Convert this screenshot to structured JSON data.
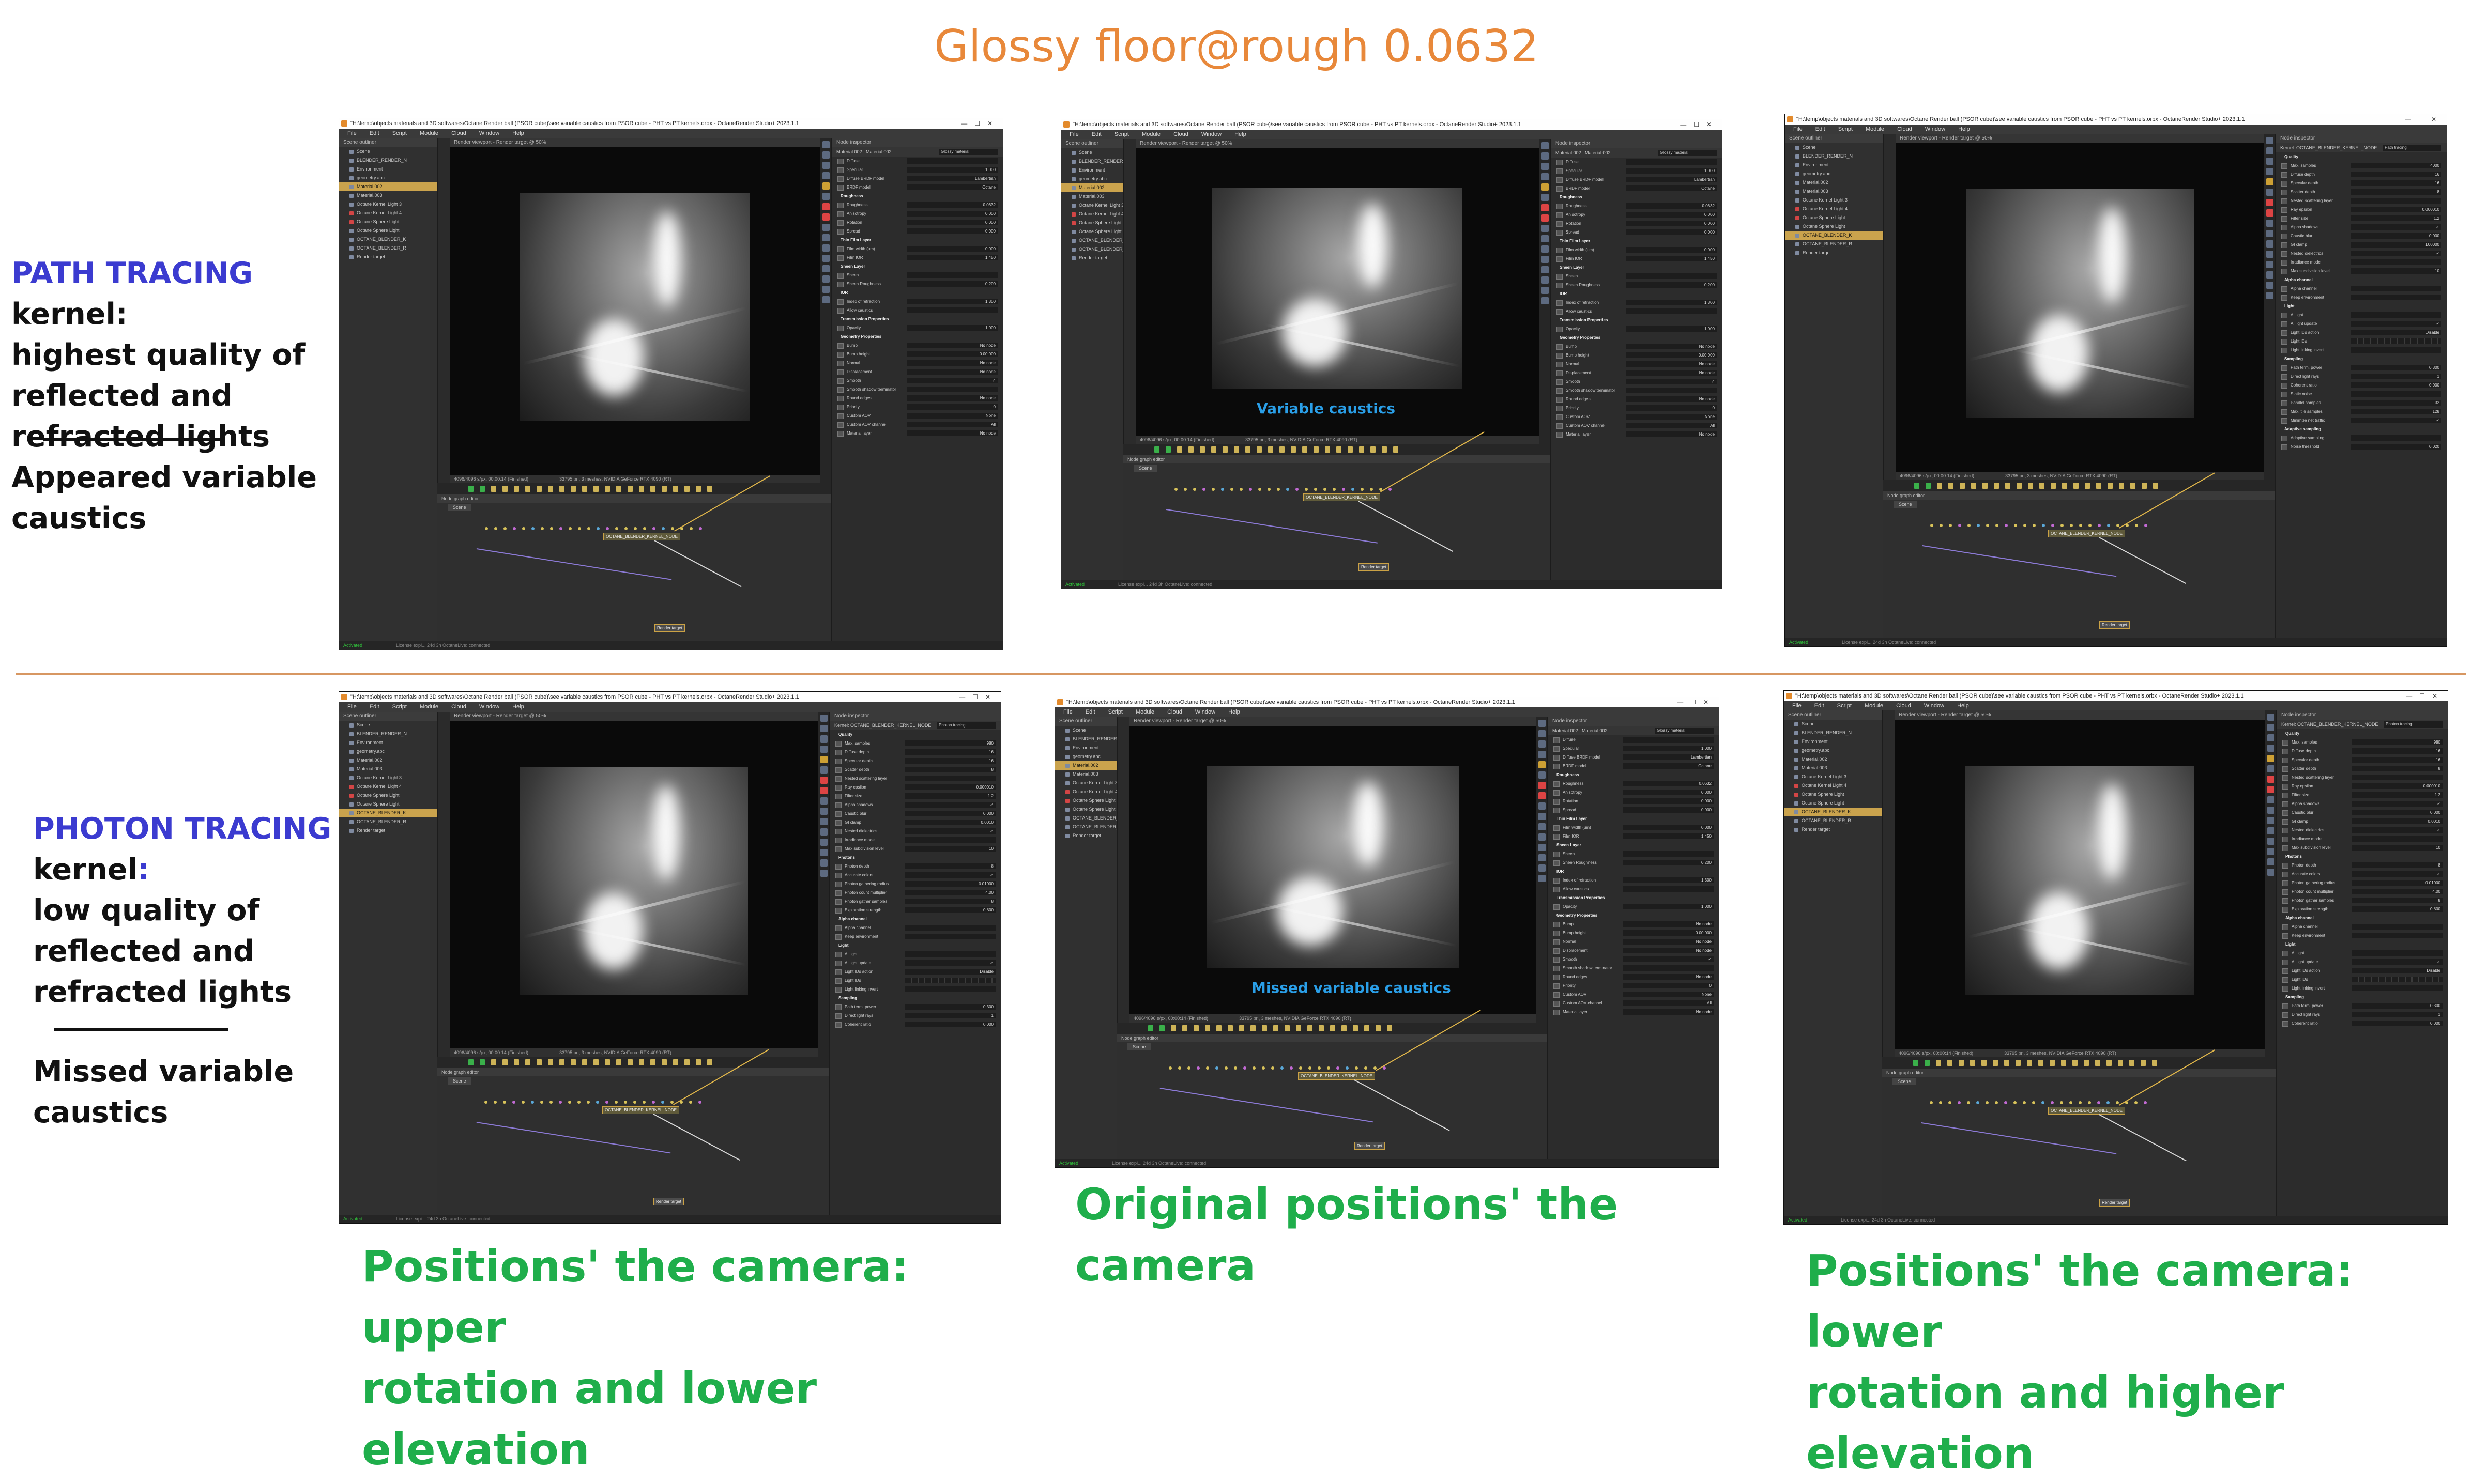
{
  "title": "Glossy floor@rough 0.0632",
  "path_tracing": {
    "kernel_name": "PATH TRACING",
    "kernel_word": " kernel:",
    "line1": "highest quality of",
    "line2": "reflected and",
    "line3": "refracted lights",
    "note1": "Appeared variable",
    "note2": "caustics"
  },
  "photon_tracing": {
    "kernel_name": "PHOTON TRACING",
    "kernel_word": "kernel",
    "colon": ":",
    "line1": "low quality of",
    "line2": "reflected and",
    "line3": "refracted lights",
    "note1": "Missed variable",
    "note2": "caustics"
  },
  "captions": {
    "top_center_viewport": "Variable caustics",
    "bottom_center_viewport": "Missed variable caustics",
    "center": "Original positions' the camera",
    "left_line1": "Positions' the camera: upper",
    "left_line2": "rotation and lower elevation",
    "right_line1": "Positions' the camera: lower",
    "right_line2": "rotation and higher elevation"
  },
  "octane": {
    "window_title": "\"H:\\temp\\objects materials and 3D softwares\\Octane Render ball (PSOR cube)\\see variable caustics from PSOR cube - PHT vs PT kernels.orbx - OctaneRender Studio+ 2023.1.1",
    "menu": "File Edit Script Module Cloud Window Help",
    "outliner_header": "Scene outliner",
    "viewport_header": "Render viewport - Render target @ 50%",
    "node_graph_header": "Node graph editor",
    "node_graph_tab": "Scene",
    "inspector_header": "Node inspector",
    "kernel_node": "OCTANE_BLENDER_KERNEL_NODE",
    "render_target_node": "Render target",
    "activated": "Activated",
    "footer": "License expi... 24d 3h     OctaneLive:     connected",
    "stats1": "4096/4096 s/px, 00:00:14 (Finished)",
    "stats2": "33795 pri, 3 meshes, NVIDIA GeForce RTX 4090 (RT)",
    "outliner_items": [
      "Scene",
      "BLENDER_RENDER_N",
      "Environment",
      "geometry.abc",
      "Material.002",
      "Material.003",
      "Octane Kernel Light 3",
      "Octane Kernel Light 4",
      "Octane Sphere Light",
      "Octane Sphere Light",
      "OCTANE_BLENDER_K",
      "OCTANE_BLENDER_R",
      "Render target"
    ],
    "material_props": {
      "material": "Material.002 : Material.002",
      "type": "Glossy material",
      "rows": [
        [
          "Diffuse",
          ""
        ],
        [
          "Specular",
          "1.000"
        ],
        [
          "Diffuse BRDF model",
          "Lambertian"
        ],
        [
          "BRDF model",
          "Octane"
        ],
        [
          "Roughness",
          ""
        ],
        [
          "Roughness",
          "0.0632"
        ],
        [
          "Anisotropy",
          "0.000"
        ],
        [
          "Rotation",
          "0.000"
        ],
        [
          "Spread",
          "0.000"
        ],
        [
          "Thin Film Layer",
          ""
        ],
        [
          "Film width (um)",
          "0.000"
        ],
        [
          "Film IOR",
          "1.450"
        ],
        [
          "Sheen Layer",
          ""
        ],
        [
          "Sheen",
          ""
        ],
        [
          "Sheen Roughness",
          "0.200"
        ],
        [
          "IOR",
          ""
        ],
        [
          "Index of refraction",
          "1.300"
        ],
        [
          "Allow caustics",
          ""
        ],
        [
          "Transmission Properties",
          ""
        ],
        [
          "Opacity",
          "1.000"
        ],
        [
          "Geometry Properties",
          ""
        ],
        [
          "Bump",
          "No node"
        ],
        [
          "Bump height",
          "0.00.000"
        ],
        [
          "Normal",
          "No node"
        ],
        [
          "Displacement",
          "No node"
        ],
        [
          "Smooth",
          "✓"
        ],
        [
          "Smooth shadow terminator",
          ""
        ],
        [
          "Round edges",
          "No node"
        ],
        [
          "Priority",
          "0"
        ],
        [
          "Custom AOV",
          "None"
        ],
        [
          "Custom AOV channel",
          "All"
        ],
        [
          "Material layer",
          "No node"
        ]
      ]
    },
    "kernel_props": {
      "material": "Kernel: OCTANE_BLENDER_KERNEL_NODE",
      "path_type": "Path tracing",
      "photon_type": "Photon tracing",
      "rows": [
        [
          "Quality",
          ""
        ],
        [
          "Max. samples",
          "4000"
        ],
        [
          "Diffuse depth",
          "16"
        ],
        [
          "Specular depth",
          "16"
        ],
        [
          "Scatter depth",
          "8"
        ],
        [
          "Nested scattering layer",
          ""
        ],
        [
          "Ray epsilon",
          "0.000010"
        ],
        [
          "Filter size",
          "1.2"
        ],
        [
          "Alpha shadows",
          "✓"
        ],
        [
          "Caustic blur",
          "0.000"
        ],
        [
          "GI clamp",
          "100000"
        ],
        [
          "Nested dielectrics",
          "✓"
        ],
        [
          "Irradiance mode",
          ""
        ],
        [
          "Max subdivision level",
          "10"
        ],
        [
          "Alpha channel",
          ""
        ],
        [
          "Alpha channel",
          ""
        ],
        [
          "Keep environment",
          ""
        ],
        [
          "Light",
          ""
        ],
        [
          "AI light",
          ""
        ],
        [
          "AI light update",
          "✓"
        ],
        [
          "Light IDs action",
          "Disable"
        ],
        [
          "Light IDs",
          ""
        ],
        [
          "Light linking invert",
          ""
        ],
        [
          "Sampling",
          ""
        ],
        [
          "Path term. power",
          "0.300"
        ],
        [
          "Direct light rays",
          "1"
        ],
        [
          "Coherent ratio",
          "0.000"
        ],
        [
          "Static noise",
          ""
        ],
        [
          "Parallel samples",
          "32"
        ],
        [
          "Max. tile samples",
          "128"
        ],
        [
          "Minimize net traffic",
          "✓"
        ],
        [
          "Adaptive sampling",
          ""
        ],
        [
          "Adaptive sampling",
          ""
        ],
        [
          "Noise threshold",
          "0.020"
        ]
      ],
      "photon_rows": [
        [
          "Quality",
          ""
        ],
        [
          "Max. samples",
          "980"
        ],
        [
          "Diffuse depth",
          "16"
        ],
        [
          "Specular depth",
          "16"
        ],
        [
          "Scatter depth",
          "8"
        ],
        [
          "Nested scattering layer",
          ""
        ],
        [
          "Ray epsilon",
          "0.000010"
        ],
        [
          "Filter size",
          "1.2"
        ],
        [
          "Alpha shadows",
          "✓"
        ],
        [
          "Caustic blur",
          "0.000"
        ],
        [
          "GI clamp",
          "0.0010"
        ],
        [
          "Nested dielectrics",
          "✓"
        ],
        [
          "Irradiance mode",
          ""
        ],
        [
          "Max subdivision level",
          "10"
        ],
        [
          "Photons",
          ""
        ],
        [
          "Photon depth",
          "8"
        ],
        [
          "Accurate colors",
          "✓"
        ],
        [
          "Photon gathering radius",
          "0.01000"
        ],
        [
          "Photon count multiplier",
          "4.00"
        ],
        [
          "Photon gather samples",
          "8"
        ],
        [
          "Exploration strength",
          "0.800"
        ],
        [
          "Alpha channel",
          ""
        ],
        [
          "Alpha channel",
          ""
        ],
        [
          "Keep environment",
          ""
        ],
        [
          "Light",
          ""
        ],
        [
          "AI light",
          ""
        ],
        [
          "AI light update",
          "✓"
        ],
        [
          "Light IDs action",
          "Disable"
        ],
        [
          "Light IDs",
          ""
        ],
        [
          "Light linking invert",
          ""
        ],
        [
          "Sampling",
          ""
        ],
        [
          "Path term. power",
          "0.300"
        ],
        [
          "Direct light rays",
          "1"
        ],
        [
          "Coherent ratio",
          "0.000"
        ]
      ]
    }
  }
}
